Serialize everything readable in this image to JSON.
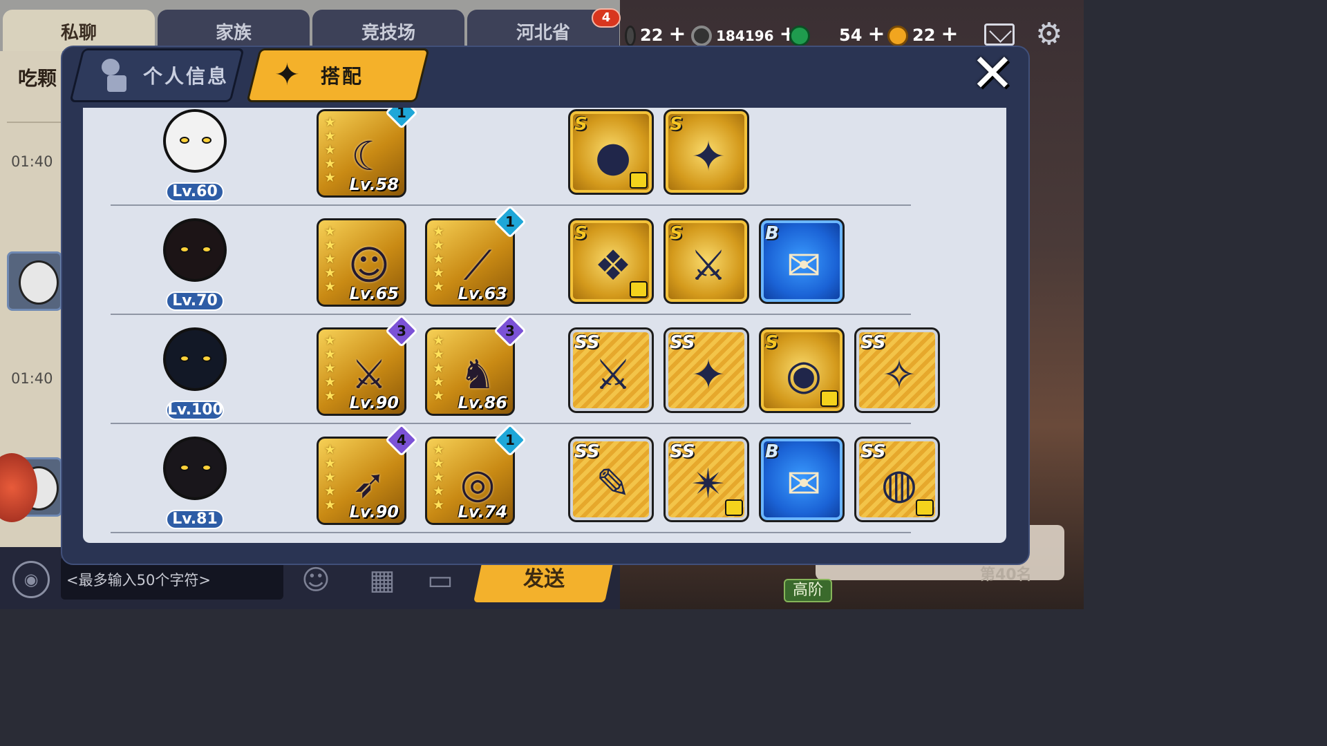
{
  "chat": {
    "tabs": [
      "私聊",
      "家族",
      "竞技场",
      "河北省"
    ],
    "badge": "4",
    "sidebar_name": "吃颗",
    "times": [
      "01:40",
      "01:40"
    ],
    "input_placeholder": "<最多输入50个字符>",
    "send_label": "发送",
    "rank_badge": "高阶",
    "rank_text": "第40名"
  },
  "resources": [
    {
      "icon": "coin-icon",
      "value": "22"
    },
    {
      "icon": "silver-coin-icon",
      "value": "184196"
    },
    {
      "icon": "green-jade-icon",
      "value": "54"
    },
    {
      "icon": "gold-jade-icon",
      "value": "22"
    }
  ],
  "modal": {
    "tabs": {
      "info": "个人信息",
      "match": "搭配"
    },
    "close_icon": "close-icon"
  },
  "rows": [
    {
      "hero": "panda",
      "level": "Lv.60",
      "weapons": [
        {
          "stars": 5,
          "lv": "Lv.58",
          "glyph": "☾",
          "upgrade": "1",
          "badge_color": "#1fa7d8"
        }
      ],
      "items": [
        {
          "tier": "S",
          "glyph": "●",
          "shirt": true
        },
        {
          "tier": "S",
          "glyph": "✦",
          "shirt": false
        }
      ]
    },
    {
      "hero": "fox-girl",
      "level": "Lv.70",
      "weapons": [
        {
          "stars": 5,
          "lv": "Lv.65",
          "glyph": "☺",
          "upgrade": "",
          "badge_color": ""
        },
        {
          "stars": 5,
          "lv": "Lv.63",
          "glyph": "⟋",
          "upgrade": "1",
          "badge_color": "#1fa7d8"
        }
      ],
      "items": [
        {
          "tier": "S",
          "glyph": "❖",
          "shirt": true
        },
        {
          "tier": "S",
          "glyph": "⚔",
          "shirt": false
        },
        {
          "tier": "B",
          "glyph": "✉",
          "shirt": false
        }
      ]
    },
    {
      "hero": "demon-mask",
      "level": "Lv.100",
      "weapons": [
        {
          "stars": 5,
          "lv": "Lv.90",
          "glyph": "⚔",
          "upgrade": "3",
          "badge_color": "#7b52d6"
        },
        {
          "stars": 5,
          "lv": "Lv.86",
          "glyph": "♞",
          "upgrade": "3",
          "badge_color": "#7b52d6"
        }
      ],
      "items": [
        {
          "tier": "SS",
          "glyph": "⚔",
          "shirt": false
        },
        {
          "tier": "SS",
          "glyph": "✦",
          "shirt": false
        },
        {
          "tier": "S",
          "glyph": "◉",
          "shirt": true
        },
        {
          "tier": "SS",
          "glyph": "✧",
          "shirt": false
        }
      ]
    },
    {
      "hero": "bun-girl",
      "level": "Lv.81",
      "weapons": [
        {
          "stars": 5,
          "lv": "Lv.90",
          "glyph": "➶",
          "upgrade": "4",
          "badge_color": "#7b52d6"
        },
        {
          "stars": 5,
          "lv": "Lv.74",
          "glyph": "◎",
          "upgrade": "1",
          "badge_color": "#1fa7d8"
        }
      ],
      "items": [
        {
          "tier": "SS",
          "glyph": "✎",
          "shirt": false
        },
        {
          "tier": "SS",
          "glyph": "✴",
          "shirt": true
        },
        {
          "tier": "B",
          "glyph": "✉",
          "shirt": false
        },
        {
          "tier": "SS",
          "glyph": "◍",
          "shirt": true
        }
      ]
    }
  ]
}
